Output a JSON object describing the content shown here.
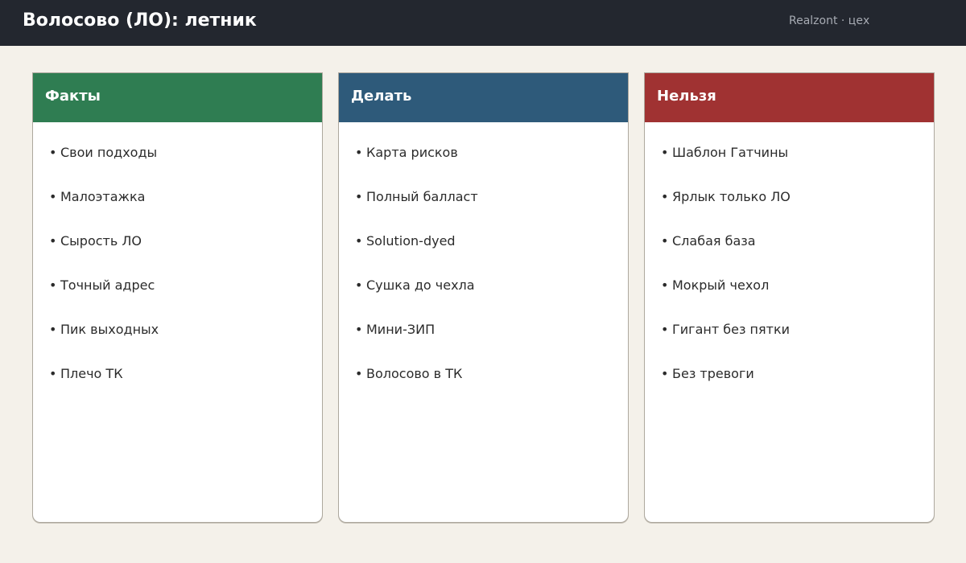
{
  "header": {
    "title": "Волосово (ЛО): летник",
    "brand": "Realzont · цех"
  },
  "colors": {
    "background": "#f4f1ea",
    "topbar": "#23272f",
    "facts": "#2f7d52",
    "do": "#2e5a7a",
    "dont": "#a03232"
  },
  "columns": [
    {
      "title": "Факты",
      "items": [
        "Свои подходы",
        "Малоэтажка",
        "Сырость ЛО",
        "Точный адрес",
        "Пик выходных",
        "Плечо ТК"
      ]
    },
    {
      "title": "Делать",
      "items": [
        "Карта рисков",
        "Полный балласт",
        "Solution-dyed",
        "Сушка до чехла",
        "Мини-ЗИП",
        "Волосово в ТК"
      ]
    },
    {
      "title": "Нельзя",
      "items": [
        "Шаблон Гатчины",
        "Ярлык только ЛО",
        "Слабая база",
        "Мокрый чехол",
        "Гигант без пятки",
        "Без тревоги"
      ]
    }
  ],
  "bullet": "•"
}
